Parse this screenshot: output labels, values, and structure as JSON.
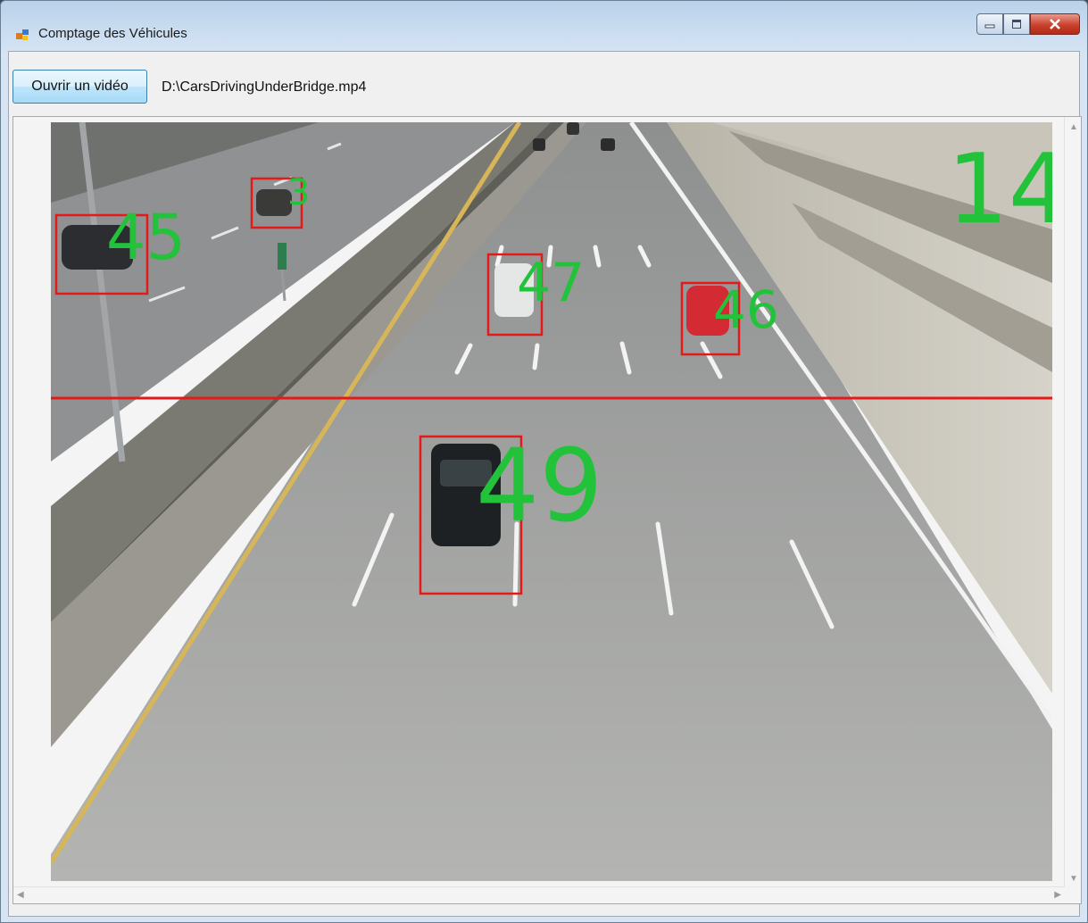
{
  "window": {
    "title": "Comptage des Véhicules"
  },
  "toolbar": {
    "open_video_label": "Ouvrir un vidéo",
    "file_path": "D:\\CarsDrivingUnderBridge.mp4"
  },
  "video": {
    "vehicle_count": "14",
    "detections": [
      {
        "id": "45"
      },
      {
        "id": "3"
      },
      {
        "id": "47"
      },
      {
        "id": "46"
      },
      {
        "id": "49"
      }
    ]
  },
  "colors": {
    "box": "#e41a1a",
    "count_text": "#22c33a",
    "counting_line": "#e41a1a"
  }
}
